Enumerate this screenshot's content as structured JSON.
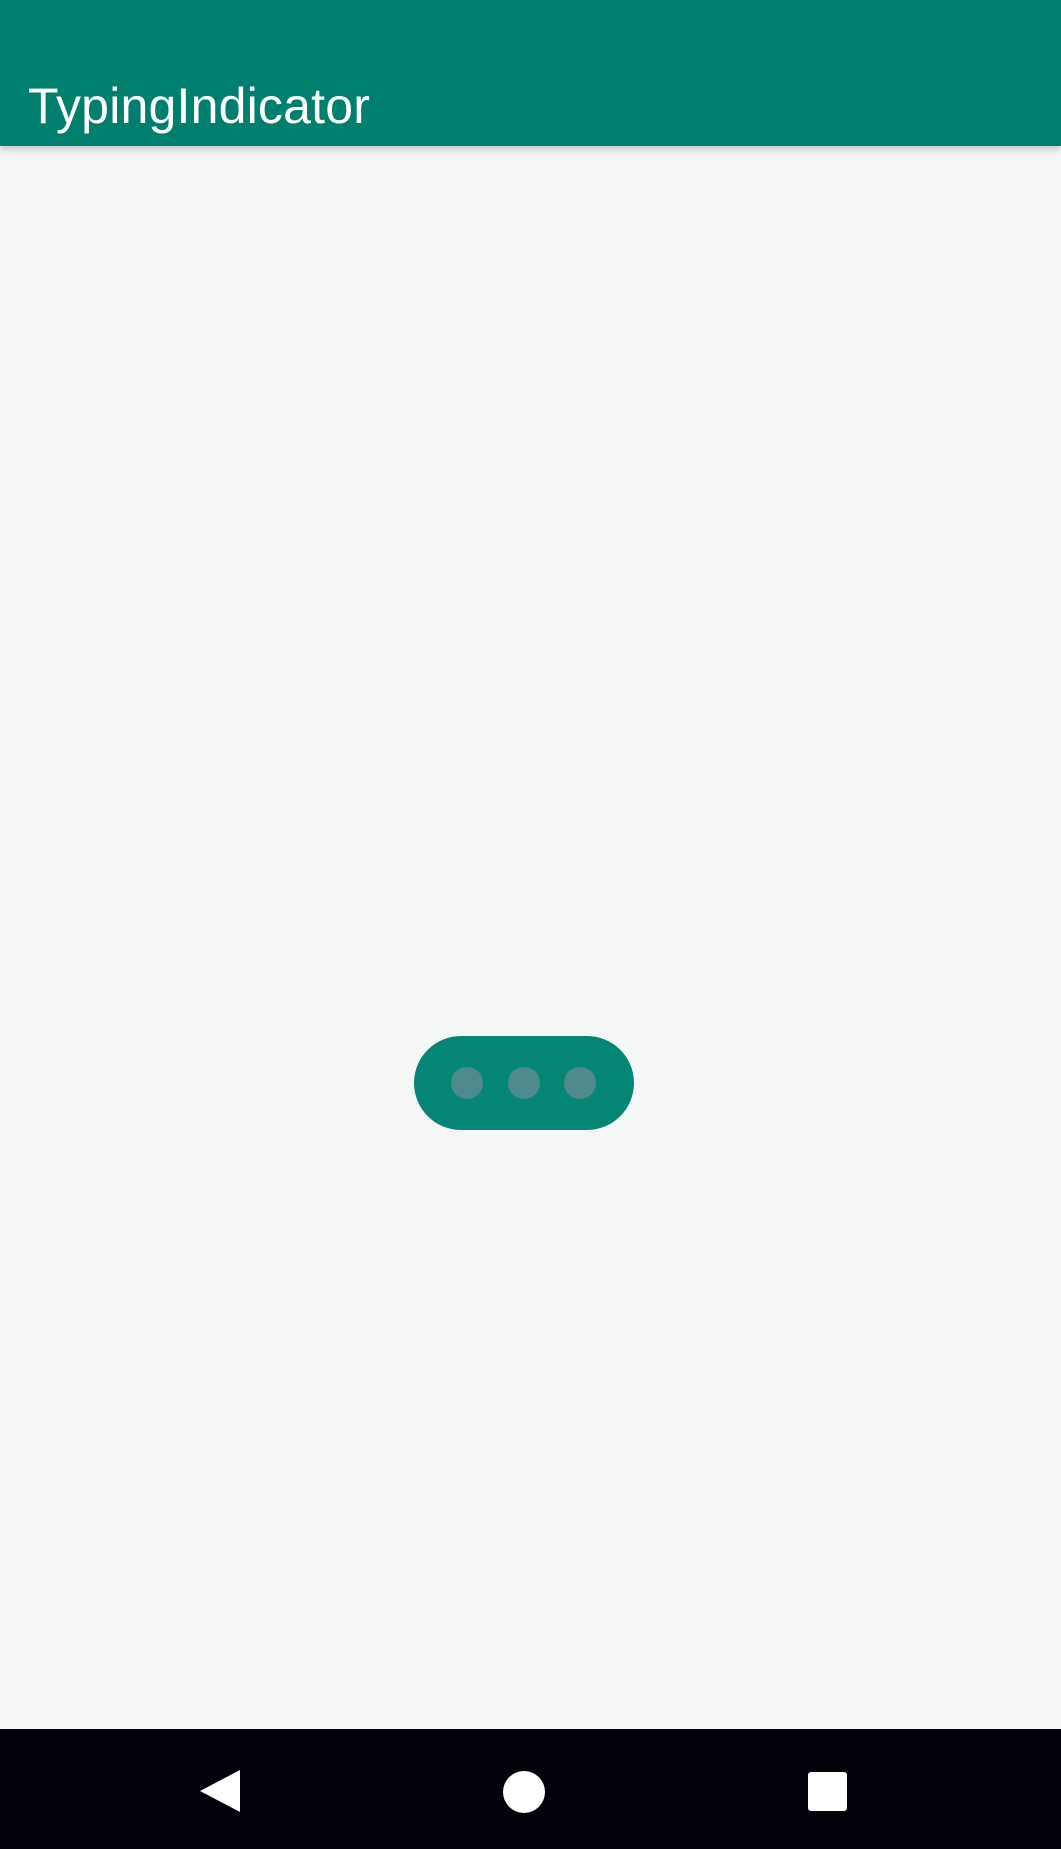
{
  "app_bar": {
    "title": "TypingIndicator"
  },
  "typing_indicator": {
    "dot_count": 3
  },
  "navigation_bar": {
    "icons": [
      "back-icon",
      "home-icon",
      "recents-icon"
    ]
  },
  "colors": {
    "app_bar": "#007f6f",
    "background": "#f5f6f6",
    "bubble": "#058573",
    "dot": "#4f8a8f",
    "navigation_bar": "#02020a",
    "navigation_icon": "#ffffff"
  }
}
